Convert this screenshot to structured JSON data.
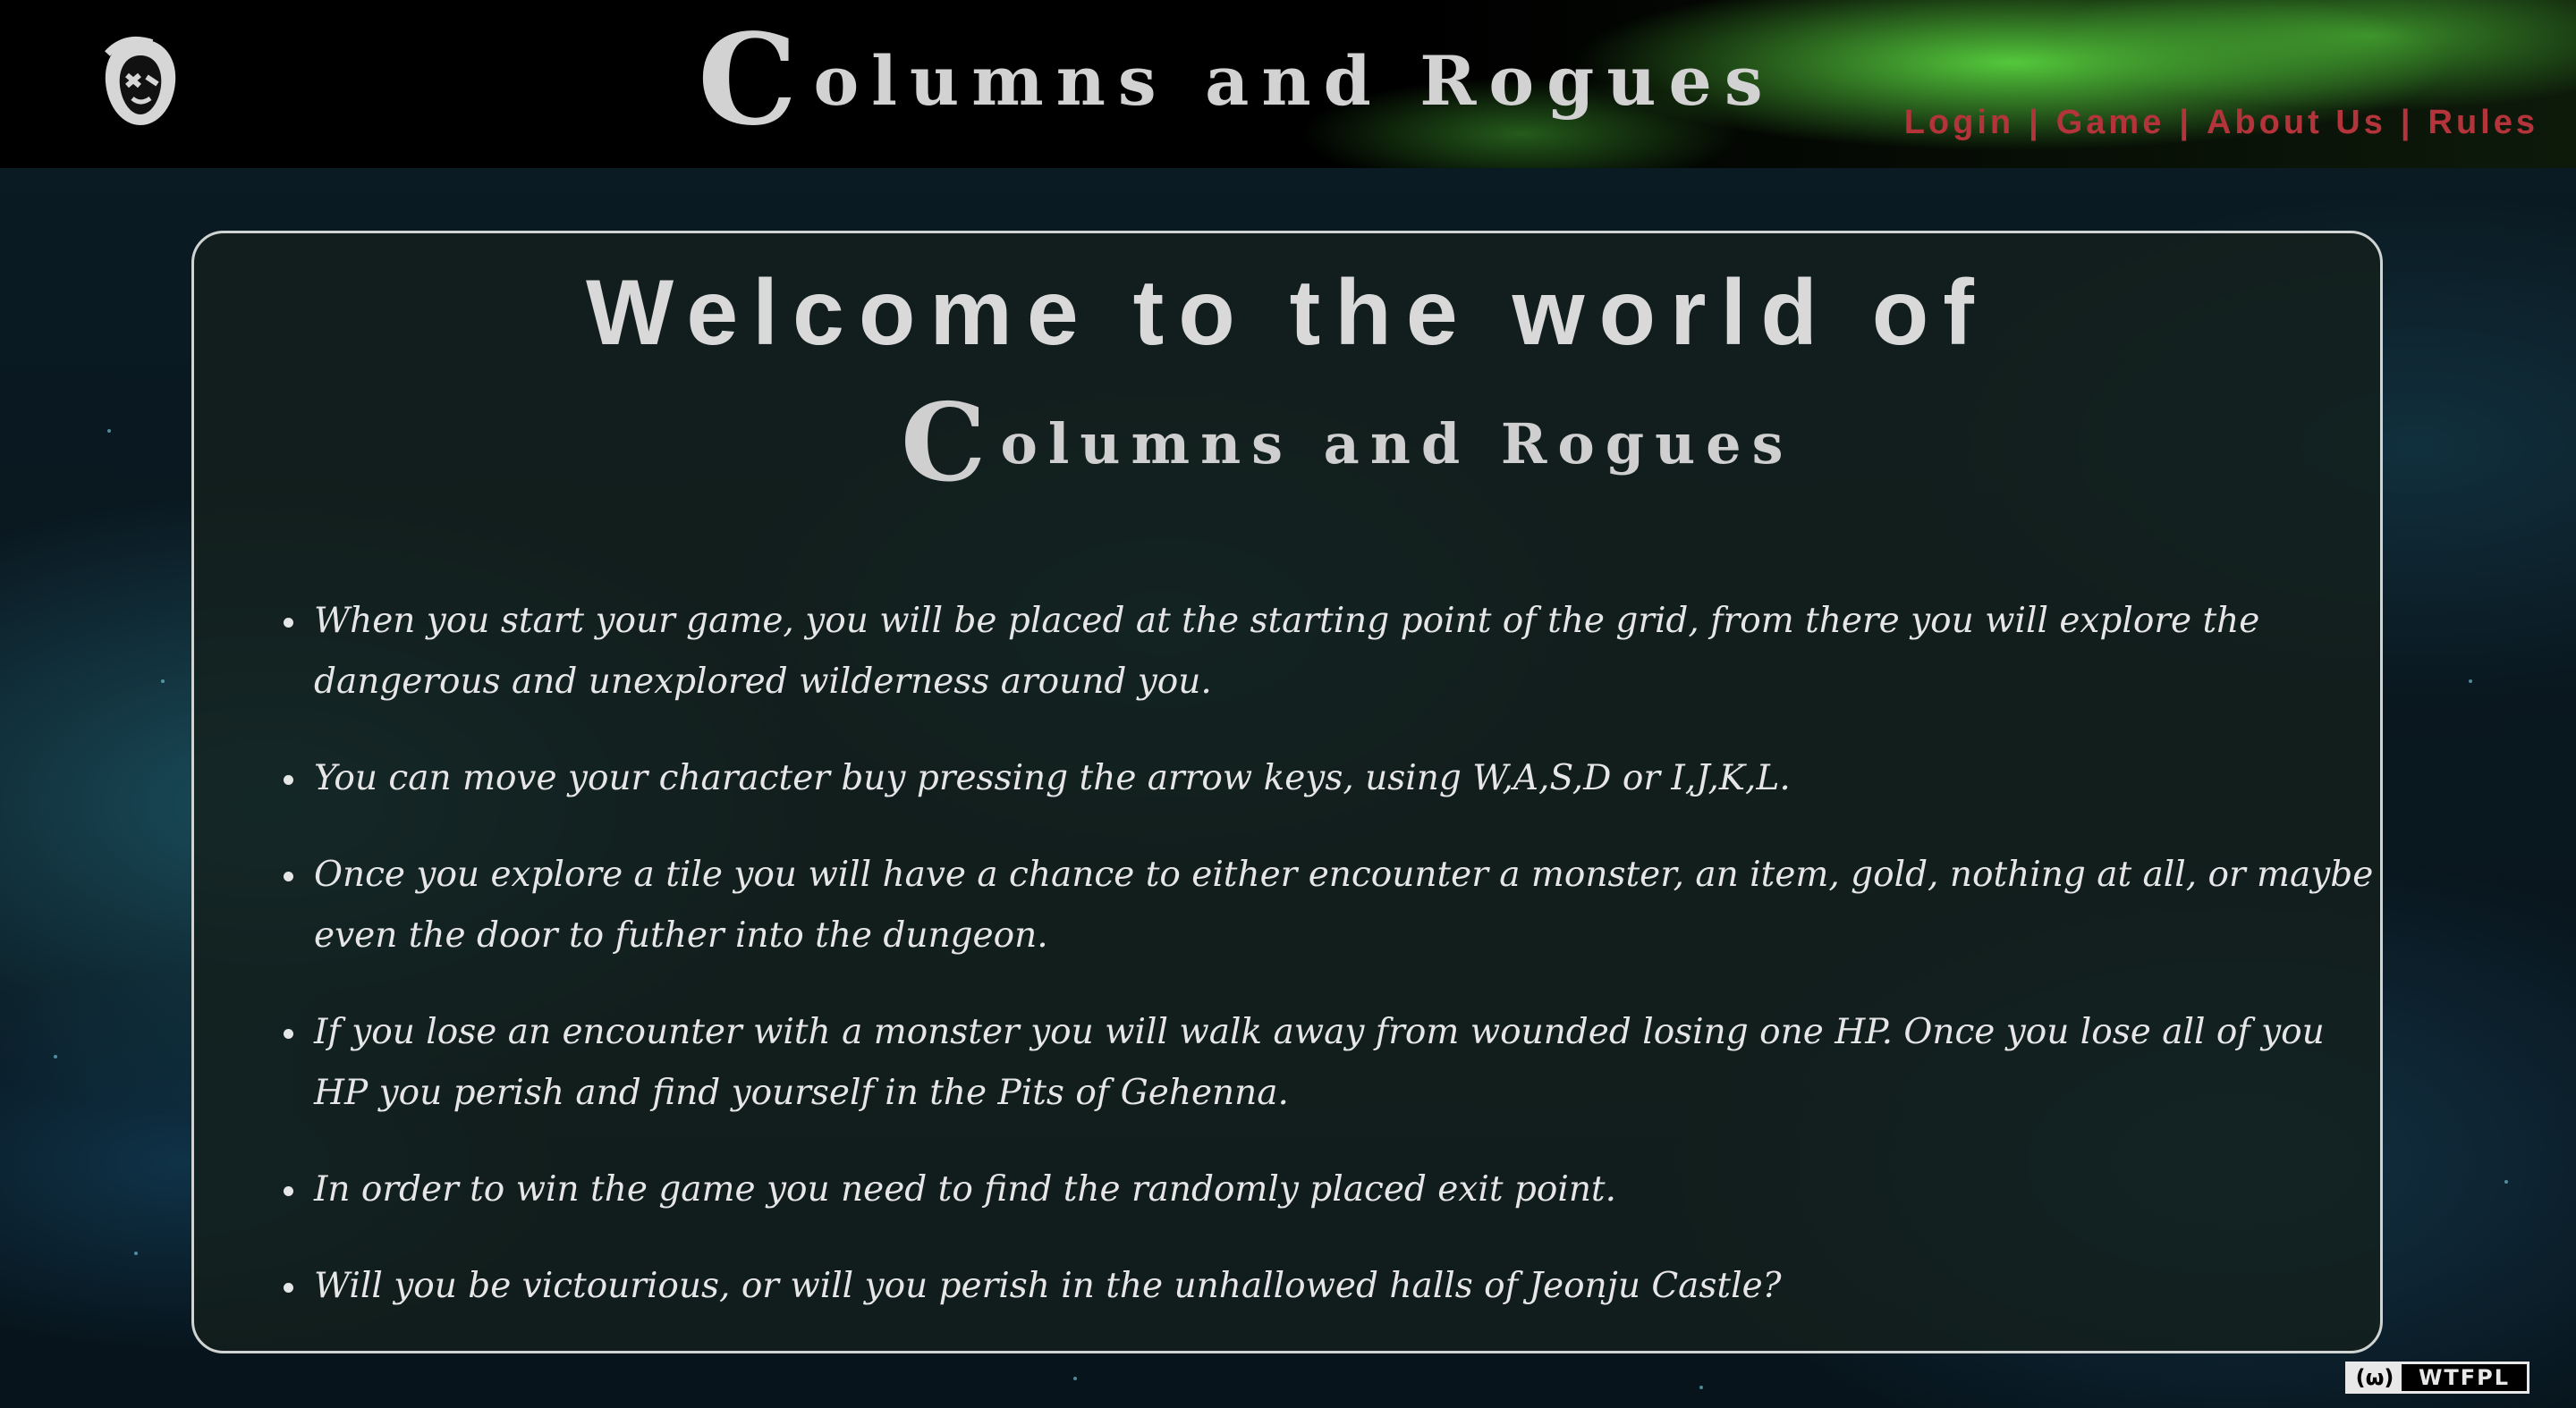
{
  "header": {
    "logo_icon": "hooded-rogue-icon",
    "brand_first": "C",
    "brand_rest": "olumns and Rogues",
    "nav": {
      "items": [
        {
          "label": "Login"
        },
        {
          "label": "Game"
        },
        {
          "label": "About Us"
        },
        {
          "label": "Rules"
        }
      ],
      "separator": "|",
      "color": "#b3343a"
    }
  },
  "main": {
    "welcome_heading": "Welcome to the world of",
    "brand_first": "C",
    "brand_rest": "olumns and Rogues",
    "rules": [
      "When you start your game, you will be placed at the starting point of the grid, from there you will explore the dangerous and unexplored wilderness around you.",
      "You can move your character buy pressing the arrow keys, using W,A,S,D or I,J,K,L.",
      "Once you explore a tile you will have a chance to either encounter a monster, an item, gold, nothing at all, or maybe even the door to futher into the dungeon.",
      "If you lose an encounter with a monster you will walk away from wounded losing one HP. Once you lose all of you HP you perish and find yourself in the Pits of Gehenna.",
      "In order to win the game you need to find the randomly placed exit point.",
      "Will you be victourious, or will you perish in the unhallowed halls of Jeonju Castle?"
    ]
  },
  "footer": {
    "license_icon": "cc-icon",
    "license_label": "WTFPL"
  }
}
